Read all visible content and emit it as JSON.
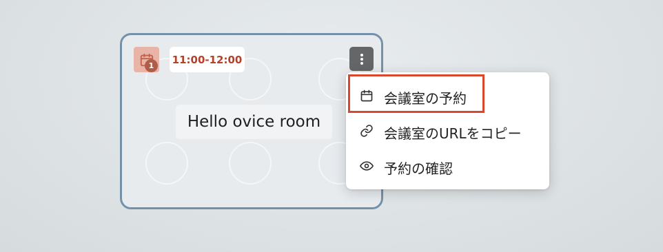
{
  "room": {
    "time": "11:00-12:00",
    "reservation_count": "1",
    "name": "Hello ovice room"
  },
  "menu": {
    "items": [
      {
        "label": "会議室の予約",
        "icon": "calendar-icon"
      },
      {
        "label": "会議室のURLをコピー",
        "icon": "link-icon"
      },
      {
        "label": "予約の確認",
        "icon": "eye-icon"
      }
    ],
    "highlighted_index": 0
  },
  "colors": {
    "card_border": "#7591a9",
    "badge_bg": "#e9b4a8",
    "badge_count_bg": "#b05d48",
    "time_text": "#b3412c",
    "highlight_border": "#d9472c"
  }
}
